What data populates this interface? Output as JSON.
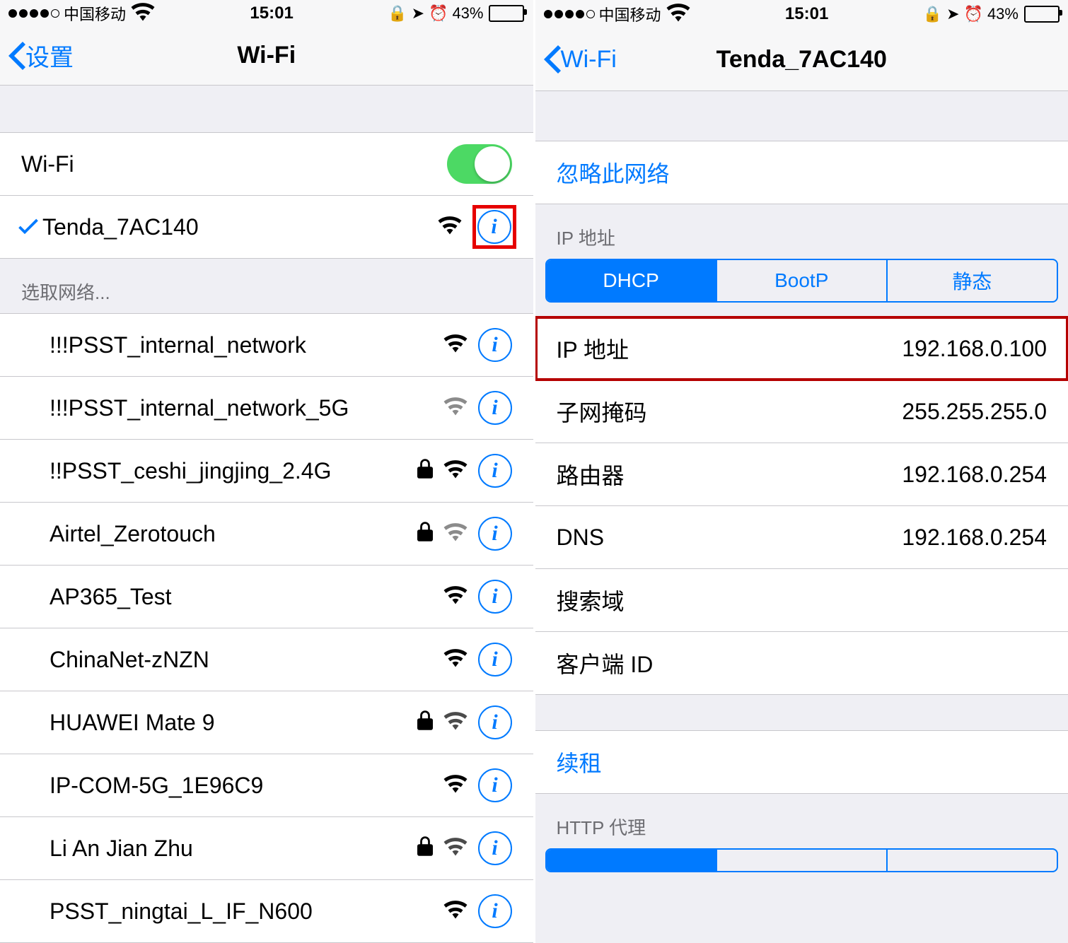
{
  "status": {
    "carrier": "中国移动",
    "time": "15:01",
    "battery_pct": "43%"
  },
  "left": {
    "back": "设置",
    "title": "Wi-Fi",
    "wifi_label": "Wi-Fi",
    "wifi_on": true,
    "connected": {
      "name": "Tenda_7AC140",
      "strength": "full",
      "locked": false
    },
    "choose_header": "选取网络...",
    "networks": [
      {
        "name": "!!!PSST_internal_network",
        "strength": "full",
        "locked": false
      },
      {
        "name": "!!!PSST_internal_network_5G",
        "strength": "weak",
        "locked": false
      },
      {
        "name": "!!PSST_ceshi_jingjing_2.4G",
        "strength": "full",
        "locked": true
      },
      {
        "name": "Airtel_Zerotouch",
        "strength": "weak",
        "locked": true
      },
      {
        "name": "AP365_Test",
        "strength": "full",
        "locked": false
      },
      {
        "name": "ChinaNet-zNZN",
        "strength": "full",
        "locked": false
      },
      {
        "name": "HUAWEI Mate 9",
        "strength": "mid",
        "locked": true
      },
      {
        "name": "IP-COM-5G_1E96C9",
        "strength": "full",
        "locked": false
      },
      {
        "name": "Li An Jian Zhu",
        "strength": "mid",
        "locked": true
      },
      {
        "name": "PSST_ningtai_L_IF_N600",
        "strength": "full",
        "locked": false
      }
    ]
  },
  "right": {
    "back": "Wi-Fi",
    "title": "Tenda_7AC140",
    "forget": "忽略此网络",
    "ip_header": "IP 地址",
    "tabs": [
      "DHCP",
      "BootP",
      "静态"
    ],
    "active_tab": 0,
    "rows": [
      {
        "k": "IP 地址",
        "v": "192.168.0.100",
        "highlight": true
      },
      {
        "k": "子网掩码",
        "v": "255.255.255.0"
      },
      {
        "k": "路由器",
        "v": "192.168.0.254"
      },
      {
        "k": "DNS",
        "v": "192.168.0.254"
      },
      {
        "k": "搜索域",
        "v": ""
      },
      {
        "k": "客户端 ID",
        "v": ""
      }
    ],
    "renew": "续租",
    "proxy_header": "HTTP 代理"
  }
}
